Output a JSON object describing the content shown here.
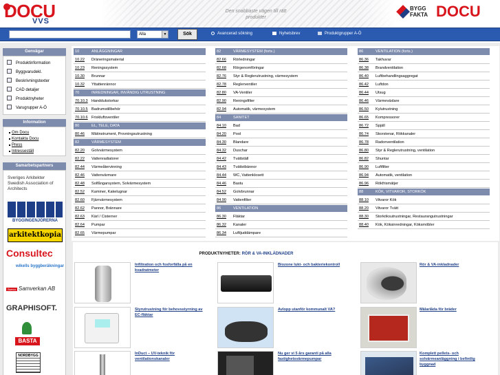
{
  "header": {
    "logo_main": "DOCU",
    "logo_sub": "VVS",
    "tagline": "Den snabbaste vägen till rätt produkter",
    "partner_logo_top": "BYGG",
    "partner_logo_bottom": "FAKTA",
    "partner_logo_main": "DOCU"
  },
  "search": {
    "input_value": "",
    "select_value": "Alla",
    "button_label": "Sök"
  },
  "toplinks": [
    {
      "label": "Avancerad sökning",
      "icon": "search-options-icon"
    },
    {
      "label": "Nyhetsbrev",
      "icon": "envelope-icon"
    },
    {
      "label": "Produktgrupper A-Ö",
      "icon": "list-icon"
    }
  ],
  "sidebar": {
    "shortcuts_title": "Genvägar",
    "shortcuts": [
      "Produktinformation",
      "Byggvarudekl.",
      "Beskrivningstexter",
      "CAD detaljer",
      "Produktnyheter",
      "Varugrupper A-Ö"
    ],
    "info_title": "Information",
    "info_links": [
      "Om Docu",
      "Kontakta Docu",
      "Press",
      "Intresseställ"
    ],
    "partners_title": "Samarbetspartners",
    "partners": [
      {
        "name": "Sveriges Arkitekter Swedish Association of Architects"
      },
      {
        "name": "BYGGINGENJÖRERNA"
      },
      {
        "name": "arkitektkopia"
      },
      {
        "name": "Consultec"
      },
      {
        "name": "wikells byggberäkningar"
      },
      {
        "name": "Sweco",
        "text2": "Samverkan AB"
      },
      {
        "name": "GRAPHISOFT."
      },
      {
        "name": "BASTA"
      },
      {
        "name": "NORDBYGG"
      }
    ]
  },
  "columns": [
    [
      {
        "code": "10",
        "name": "ANLÄGGNINGAR",
        "header": true
      },
      {
        "code": "10.22",
        "name": "Dräneringsmaterial"
      },
      {
        "code": "10.23",
        "name": "Reningssystem"
      },
      {
        "code": "10.30",
        "name": "Brunnar"
      },
      {
        "code": "10.32",
        "name": "Yttattenrännor"
      },
      {
        "code": "70",
        "name": "INREDNINGAR, INVÄNDIG UTRUSTNING",
        "header": true
      },
      {
        "code": "70.10.3",
        "name": "Handdukstorkar"
      },
      {
        "code": "70.10.5",
        "name": "Badrumstillbehör"
      },
      {
        "code": "70.10.6",
        "name": "Friskluftsventiler"
      },
      {
        "code": "80",
        "name": "EL, TELE, DATA",
        "header": true
      },
      {
        "code": "80.46",
        "name": "Mätinstrument, Provningsutrustning"
      },
      {
        "code": "82",
        "name": "VÄRMESYSTEM",
        "header": true
      },
      {
        "code": "82.20",
        "name": "Golvvärmesystem"
      },
      {
        "code": "82.22",
        "name": "Vattenradiatorer"
      },
      {
        "code": "82.44",
        "name": "Värmeåtervinning"
      },
      {
        "code": "82.46",
        "name": "Vattenvärmare"
      },
      {
        "code": "82.48",
        "name": "Solfångarsystem, Solvärmesystem"
      },
      {
        "code": "82.52",
        "name": "Kaminer, Kakelugnar"
      },
      {
        "code": "82.60",
        "name": "Fjärrvärmesystem"
      },
      {
        "code": "82.62",
        "name": "Pannor, Brännare"
      },
      {
        "code": "82.63",
        "name": "Kärl / Cisterner"
      },
      {
        "code": "82.64",
        "name": "Pumpar"
      },
      {
        "code": "82.65",
        "name": "Värmepumpar"
      }
    ],
    [
      {
        "code": "82",
        "name": "VÄRMESYSTEM (forts.)",
        "header": true
      },
      {
        "code": "82.66",
        "name": "Rörledningar"
      },
      {
        "code": "82.68",
        "name": "Rörgenomföringar"
      },
      {
        "code": "82.76",
        "name": "Styr & Reglerutrustning, värmesystem"
      },
      {
        "code": "82.78",
        "name": "Reglerventiler"
      },
      {
        "code": "82.80",
        "name": "VA-Ventiler"
      },
      {
        "code": "82.90",
        "name": "Reningsfilter"
      },
      {
        "code": "82.94",
        "name": "Automatik, värmesystem"
      },
      {
        "code": "84",
        "name": "SANITET",
        "header": true
      },
      {
        "code": "84.10",
        "name": "Bad"
      },
      {
        "code": "84.20",
        "name": "Pool"
      },
      {
        "code": "84.30",
        "name": "Blandare"
      },
      {
        "code": "84.32",
        "name": "Duschar"
      },
      {
        "code": "84.42",
        "name": "Tvättställ"
      },
      {
        "code": "84.43",
        "name": "Tvättstbännor"
      },
      {
        "code": "84.44",
        "name": "WC, Vattenklosett"
      },
      {
        "code": "84.46",
        "name": "Bastu"
      },
      {
        "code": "84.52",
        "name": "Golvbrunnar"
      },
      {
        "code": "84.90",
        "name": "Vattenfilter"
      },
      {
        "code": "86",
        "name": "VENTILATION",
        "header": true
      },
      {
        "code": "86.30",
        "name": "Fläktar"
      },
      {
        "code": "86.32",
        "name": "Kanaler"
      },
      {
        "code": "86.34",
        "name": "Luftljuddämpare"
      }
    ],
    [
      {
        "code": "86",
        "name": "VENTILATION (forts.)",
        "header": true
      },
      {
        "code": "86.36",
        "name": "Takhuvar"
      },
      {
        "code": "86.38",
        "name": "Brandventilation"
      },
      {
        "code": "86.40",
        "name": "Luftbehandlingsaggregat"
      },
      {
        "code": "86.42",
        "name": "Luftdon"
      },
      {
        "code": "86.44",
        "name": "Utsug"
      },
      {
        "code": "86.46",
        "name": "Värmeväxlare"
      },
      {
        "code": "86.50",
        "name": "Kylutrustning"
      },
      {
        "code": "86.65",
        "name": "Kompressorer"
      },
      {
        "code": "86.72",
        "name": "Spjäll"
      },
      {
        "code": "86.74",
        "name": "Skorstenar, Rökkanaler"
      },
      {
        "code": "86.78",
        "name": "Radonventilation"
      },
      {
        "code": "86.80",
        "name": "Styr & Reglerutrustning, ventilation"
      },
      {
        "code": "86.82",
        "name": "Shuntar"
      },
      {
        "code": "86.90",
        "name": "Luftfilter"
      },
      {
        "code": "86.94",
        "name": "Automatik, ventilation"
      },
      {
        "code": "86.96",
        "name": "Rökfrismätjer"
      },
      {
        "code": "88",
        "name": "KÖK, VITVAROR, STORKÖK",
        "header": true
      },
      {
        "code": "88.10",
        "name": "Vitvaror Kök"
      },
      {
        "code": "88.20",
        "name": "Vitvaror Tvätt"
      },
      {
        "code": "88.30",
        "name": "Storköksutrustningar, Restaurangutrustningar"
      },
      {
        "code": "88.40",
        "name": "Kök, Köksinredningar, Köksmöbler"
      }
    ]
  ],
  "products": {
    "title": "PRODUKTNYHETER:",
    "title_link": "RÖR & VA-INKLÄDNADER",
    "items": [
      {
        "text": "Infiltration och fosforfälla på en kvadratmeter"
      },
      {
        "text": "Biozone lukt- och bakteriekontroll"
      },
      {
        "text": "Rör & VA-inkladnader"
      },
      {
        "text": "Styrutrustning för behovsstyrning av EC-fläktar"
      },
      {
        "text": "Avlopp utanför kommunalt VA?"
      },
      {
        "text": "Mälarlåda för bräder"
      },
      {
        "text": "InDuct – UV-teknik för ventilationskanaler"
      },
      {
        "text": "Nu ger vi 5 års garanti på alla fastighetsvärmepumpar"
      },
      {
        "text": "Komplett pellets- och solvärmeanläggning i befintlig byggnad"
      }
    ]
  }
}
